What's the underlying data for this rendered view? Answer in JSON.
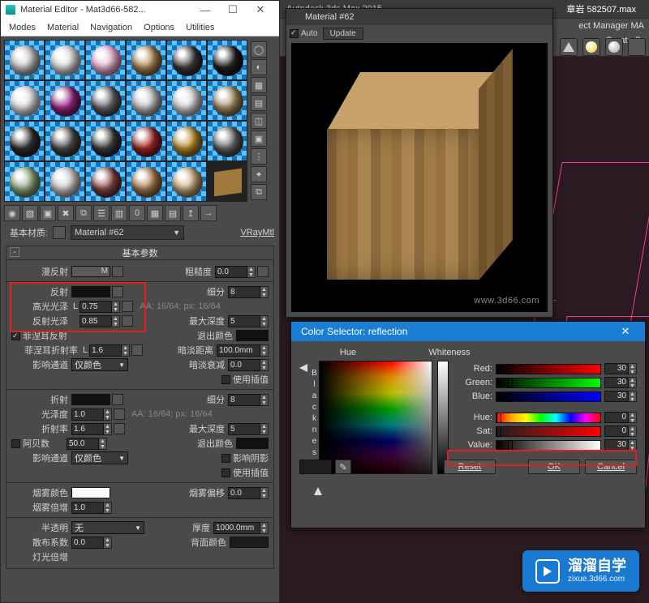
{
  "max": {
    "product": "Autodesk 3ds Max 2015",
    "document": "章岩 582507.max",
    "panel_tab": "ect Manager   MA",
    "create_btn": "Create S"
  },
  "matedit": {
    "title": "Material Editor - Mat3d66-582...",
    "menus": [
      "Modes",
      "Material",
      "Navigation",
      "Options",
      "Utilities"
    ],
    "base_label": "基本材质:",
    "mat_name": "Material #62",
    "mat_type": "VRayMtl"
  },
  "rollout": {
    "title": "基本参数",
    "diffuse": "漫反射",
    "roughness_label": "粗糙度",
    "roughness": "0.0",
    "reflect": "反射",
    "subdiv_label": "细分",
    "subdiv": "8",
    "hg_gloss_label": "高光光泽",
    "hg_gloss": "0.75",
    "aa_text": "AA: 16/64; px: 16/64",
    "refl_gloss_label": "反射光泽",
    "refl_gloss": "0.85",
    "maxdepth_label": "最大深度",
    "maxdepth": "5",
    "fresnel_label": "菲涅耳反射",
    "exitcolor_label": "退出颜色",
    "fresnel_ior_label": "菲涅耳折射率",
    "fresnel_ior": "1.6",
    "dimdist_label": "暗淡距离",
    "dimdist": "100.0mm",
    "affect_label": "影响通道",
    "affect_opt": "仅颜色",
    "dimfall_label": "暗淡衰减",
    "dimfall": "0.0",
    "useinterp_label": "使用插值",
    "refract": "折射",
    "gloss_label": "光泽度",
    "gloss": "1.0",
    "ior_label": "折射率",
    "ior": "1.6",
    "abbe_label": "阿贝数",
    "abbe": "50.0",
    "affectshadow_label": "影响阴影",
    "fogcolor_label": "烟雾颜色",
    "fogbias_label": "烟雾偏移",
    "fogbias": "0.0",
    "fogmult_label": "烟雾倍增",
    "fogmult": "1.0",
    "translucent_label": "半透明",
    "translucent_opt": "无",
    "thickness_label": "厚度",
    "thickness": "1000.0mm",
    "scatter_label": "散布系数",
    "scatter": "0.0",
    "backcolor_label": "背面颜色",
    "lightmult_label": "灯光倍增",
    "L": "L"
  },
  "preview": {
    "title": "Material #62",
    "auto": "Auto",
    "update": "Update",
    "watermark": "www.3d66.com"
  },
  "colorsel": {
    "title": "Color Selector: reflection",
    "hue": "Hue",
    "whiteness": "Whiteness",
    "blackness": "Blackness",
    "red_l": "Red:",
    "red_v": "30",
    "green_l": "Green:",
    "green_v": "30",
    "blue_l": "Blue:",
    "blue_v": "30",
    "hue_l": "Hue:",
    "hue_v": "0",
    "sat_l": "Sat:",
    "sat_v": "0",
    "val_l": "Value:",
    "val_v": "30",
    "reset": "Reset",
    "ok": "OK",
    "cancel": "Cancel"
  },
  "brand": {
    "cn": "溜溜自学",
    "url": "zixue.3d66.com"
  }
}
